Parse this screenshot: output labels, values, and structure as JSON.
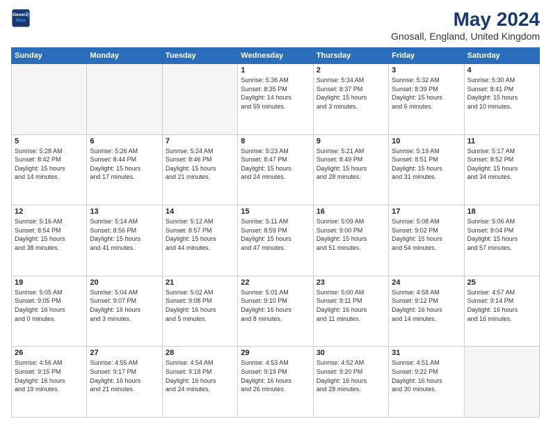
{
  "header": {
    "logo_line1": "General",
    "logo_line2": "Blue",
    "title": "May 2024",
    "subtitle": "Gnosall, England, United Kingdom"
  },
  "weekdays": [
    "Sunday",
    "Monday",
    "Tuesday",
    "Wednesday",
    "Thursday",
    "Friday",
    "Saturday"
  ],
  "weeks": [
    [
      {
        "day": "",
        "info": ""
      },
      {
        "day": "",
        "info": ""
      },
      {
        "day": "",
        "info": ""
      },
      {
        "day": "1",
        "info": "Sunrise: 5:36 AM\nSunset: 8:35 PM\nDaylight: 14 hours\nand 59 minutes."
      },
      {
        "day": "2",
        "info": "Sunrise: 5:34 AM\nSunset: 8:37 PM\nDaylight: 15 hours\nand 3 minutes."
      },
      {
        "day": "3",
        "info": "Sunrise: 5:32 AM\nSunset: 8:39 PM\nDaylight: 15 hours\nand 6 minutes."
      },
      {
        "day": "4",
        "info": "Sunrise: 5:30 AM\nSunset: 8:41 PM\nDaylight: 15 hours\nand 10 minutes."
      }
    ],
    [
      {
        "day": "5",
        "info": "Sunrise: 5:28 AM\nSunset: 8:42 PM\nDaylight: 15 hours\nand 14 minutes."
      },
      {
        "day": "6",
        "info": "Sunrise: 5:26 AM\nSunset: 8:44 PM\nDaylight: 15 hours\nand 17 minutes."
      },
      {
        "day": "7",
        "info": "Sunrise: 5:24 AM\nSunset: 8:46 PM\nDaylight: 15 hours\nand 21 minutes."
      },
      {
        "day": "8",
        "info": "Sunrise: 5:23 AM\nSunset: 8:47 PM\nDaylight: 15 hours\nand 24 minutes."
      },
      {
        "day": "9",
        "info": "Sunrise: 5:21 AM\nSunset: 8:49 PM\nDaylight: 15 hours\nand 28 minutes."
      },
      {
        "day": "10",
        "info": "Sunrise: 5:19 AM\nSunset: 8:51 PM\nDaylight: 15 hours\nand 31 minutes."
      },
      {
        "day": "11",
        "info": "Sunrise: 5:17 AM\nSunset: 8:52 PM\nDaylight: 15 hours\nand 34 minutes."
      }
    ],
    [
      {
        "day": "12",
        "info": "Sunrise: 5:16 AM\nSunset: 8:54 PM\nDaylight: 15 hours\nand 38 minutes."
      },
      {
        "day": "13",
        "info": "Sunrise: 5:14 AM\nSunset: 8:56 PM\nDaylight: 15 hours\nand 41 minutes."
      },
      {
        "day": "14",
        "info": "Sunrise: 5:12 AM\nSunset: 8:57 PM\nDaylight: 15 hours\nand 44 minutes."
      },
      {
        "day": "15",
        "info": "Sunrise: 5:11 AM\nSunset: 8:59 PM\nDaylight: 15 hours\nand 47 minutes."
      },
      {
        "day": "16",
        "info": "Sunrise: 5:09 AM\nSunset: 9:00 PM\nDaylight: 15 hours\nand 51 minutes."
      },
      {
        "day": "17",
        "info": "Sunrise: 5:08 AM\nSunset: 9:02 PM\nDaylight: 15 hours\nand 54 minutes."
      },
      {
        "day": "18",
        "info": "Sunrise: 5:06 AM\nSunset: 9:04 PM\nDaylight: 15 hours\nand 57 minutes."
      }
    ],
    [
      {
        "day": "19",
        "info": "Sunrise: 5:05 AM\nSunset: 9:05 PM\nDaylight: 16 hours\nand 0 minutes."
      },
      {
        "day": "20",
        "info": "Sunrise: 5:04 AM\nSunset: 9:07 PM\nDaylight: 16 hours\nand 3 minutes."
      },
      {
        "day": "21",
        "info": "Sunrise: 5:02 AM\nSunset: 9:08 PM\nDaylight: 16 hours\nand 5 minutes."
      },
      {
        "day": "22",
        "info": "Sunrise: 5:01 AM\nSunset: 9:10 PM\nDaylight: 16 hours\nand 8 minutes."
      },
      {
        "day": "23",
        "info": "Sunrise: 5:00 AM\nSunset: 9:11 PM\nDaylight: 16 hours\nand 11 minutes."
      },
      {
        "day": "24",
        "info": "Sunrise: 4:58 AM\nSunset: 9:12 PM\nDaylight: 16 hours\nand 14 minutes."
      },
      {
        "day": "25",
        "info": "Sunrise: 4:57 AM\nSunset: 9:14 PM\nDaylight: 16 hours\nand 16 minutes."
      }
    ],
    [
      {
        "day": "26",
        "info": "Sunrise: 4:56 AM\nSunset: 9:15 PM\nDaylight: 16 hours\nand 19 minutes."
      },
      {
        "day": "27",
        "info": "Sunrise: 4:55 AM\nSunset: 9:17 PM\nDaylight: 16 hours\nand 21 minutes."
      },
      {
        "day": "28",
        "info": "Sunrise: 4:54 AM\nSunset: 9:18 PM\nDaylight: 16 hours\nand 24 minutes."
      },
      {
        "day": "29",
        "info": "Sunrise: 4:53 AM\nSunset: 9:19 PM\nDaylight: 16 hours\nand 26 minutes."
      },
      {
        "day": "30",
        "info": "Sunrise: 4:52 AM\nSunset: 9:20 PM\nDaylight: 16 hours\nand 28 minutes."
      },
      {
        "day": "31",
        "info": "Sunrise: 4:51 AM\nSunset: 9:22 PM\nDaylight: 16 hours\nand 30 minutes."
      },
      {
        "day": "",
        "info": ""
      }
    ]
  ]
}
